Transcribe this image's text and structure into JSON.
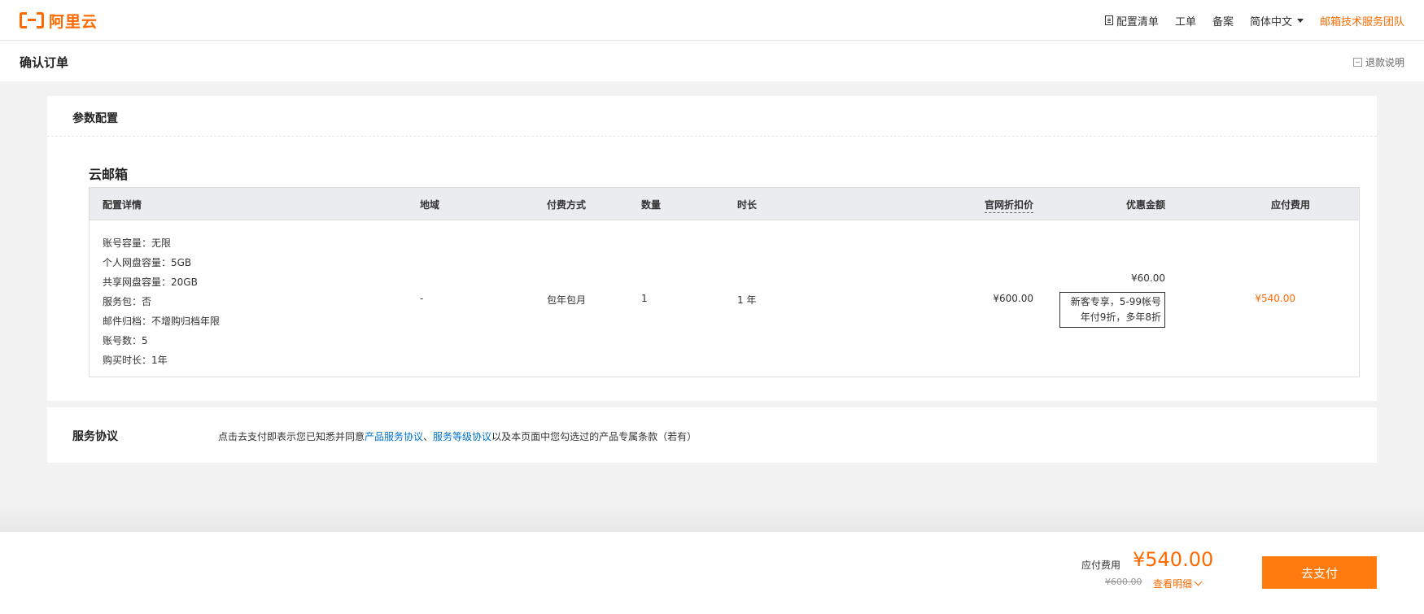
{
  "header": {
    "logo_text": "阿里云",
    "nav": {
      "config_list": "配置清单",
      "ticket": "工单",
      "filing": "备案",
      "language": "简体中文",
      "team": "邮箱技术服务团队"
    }
  },
  "page": {
    "title": "确认订单",
    "refund": "退款说明"
  },
  "config_section": {
    "title": "参数配置",
    "product": "云邮箱",
    "columns": {
      "config": "配置详情",
      "region": "地域",
      "payment": "付费方式",
      "quantity": "数量",
      "duration": "时长",
      "official_price": "官网折扣价",
      "discount": "优惠金额",
      "payable": "应付费用"
    },
    "row": {
      "config_items": [
        "账号容量：无限",
        "个人网盘容量：5GB",
        "共享网盘容量：20GB",
        "服务包：否",
        "邮件归档：不增购归档年限",
        "账号数：5",
        "购买时长：1年"
      ],
      "region": "-",
      "payment": "包年包月",
      "quantity": "1",
      "duration": "1 年",
      "official_price": "¥600.00",
      "discount_amount": "¥60.00",
      "discount_note_1": "新客专享，5-99帐号",
      "discount_note_2": "年付9折，多年8折",
      "payable": "¥540.00"
    }
  },
  "agreement": {
    "label": "服务协议",
    "text_before": "点击去支付即表示您已知悉并同意",
    "link1": "产品服务协议",
    "sep": "、",
    "link2": "服务等级协议",
    "text_after": "以及本页面中您勾选过的产品专属条款（若有）"
  },
  "footer": {
    "fee_label": "应付费用",
    "total": "¥540.00",
    "original": "¥600.00",
    "detail": "查看明细",
    "pay_button": "去支付"
  },
  "colors": {
    "accent": "#ff6a00",
    "link": "#0070cc"
  }
}
